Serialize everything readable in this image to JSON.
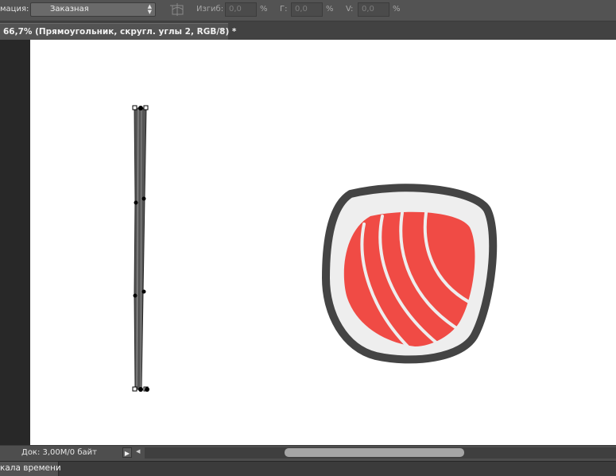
{
  "options_bar": {
    "mode_label": "мация:",
    "warp_style_value": "Заказная",
    "bend_label": "Изгиб:",
    "bend_value": "0,0",
    "h_label": "Г:",
    "h_value": "0,0",
    "v_label": "V:",
    "v_value": "0,0",
    "percent": "%"
  },
  "document_tab": {
    "title": "66,7% (Прямоугольник, скругл. углы 2, RGB/8) *",
    "close": "×"
  },
  "status_bar": {
    "doc_info": "Док: 3,00M/0 байт"
  },
  "bottom_panel": {
    "timeline_label": "кала времени"
  },
  "colors": {
    "salmon": "#f04b45",
    "outline": "#444444",
    "rice": "#eeeeee",
    "stroke": "#6a6a6a"
  },
  "icons": [
    "warp-icon",
    "dropdown-arrows-icon",
    "play-icon",
    "scroll-left-icon",
    "close-icon"
  ]
}
